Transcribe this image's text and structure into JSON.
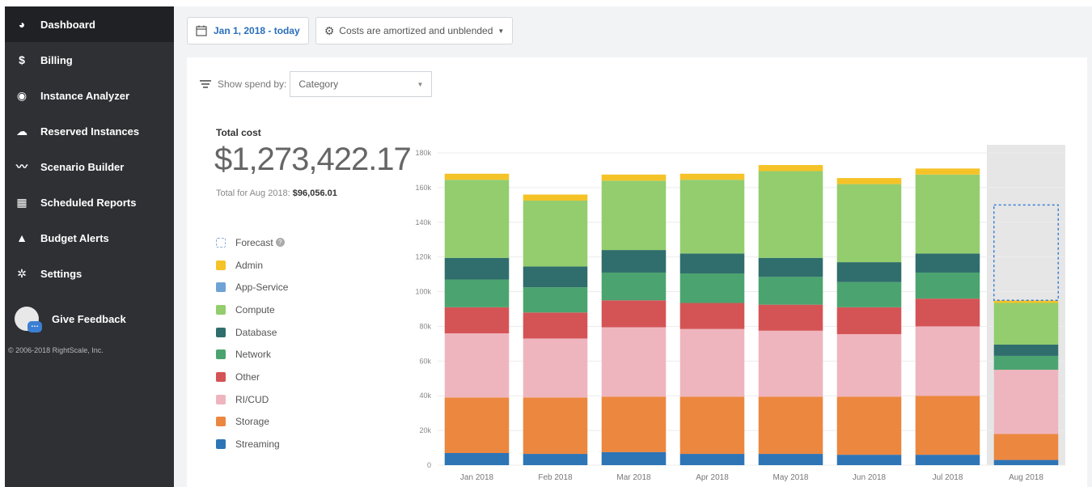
{
  "sidebar": {
    "items": [
      {
        "label": "Dashboard",
        "icon": "dashboard-icon",
        "active": true
      },
      {
        "label": "Billing",
        "icon": "dollar-icon"
      },
      {
        "label": "Instance Analyzer",
        "icon": "eye-icon"
      },
      {
        "label": "Reserved Instances",
        "icon": "cloud-reserved-icon"
      },
      {
        "label": "Scenario Builder",
        "icon": "pulse-icon"
      },
      {
        "label": "Scheduled Reports",
        "icon": "calendar-icon"
      },
      {
        "label": "Budget Alerts",
        "icon": "bell-icon"
      },
      {
        "label": "Settings",
        "icon": "gear-icon"
      }
    ],
    "feedback_label": "Give Feedback",
    "copyright": "© 2006-2018 RightScale, Inc."
  },
  "toolbar": {
    "date_range": "Jan 1, 2018 - today",
    "costs_label": "Costs are amortized and unblended"
  },
  "filters": {
    "show_spend_by_label": "Show spend by:",
    "category_value": "Category"
  },
  "summary": {
    "total_label": "Total cost",
    "total_value": "$1,273,422.17",
    "month_label": "Total for Aug 2018:",
    "month_value": "$96,056.01"
  },
  "legend": {
    "forecast": "Forecast",
    "items": [
      {
        "label": "Admin",
        "color": "#f5c327"
      },
      {
        "label": "App-Service",
        "color": "#6fa3d6"
      },
      {
        "label": "Compute",
        "color": "#93cd6e"
      },
      {
        "label": "Database",
        "color": "#2f6e6c"
      },
      {
        "label": "Network",
        "color": "#4ba46f"
      },
      {
        "label": "Other",
        "color": "#d45456"
      },
      {
        "label": "RI/CUD",
        "color": "#efb5be"
      },
      {
        "label": "Storage",
        "color": "#ec873f"
      },
      {
        "label": "Streaming",
        "color": "#2e75b6"
      }
    ]
  },
  "chart_data": {
    "type": "bar",
    "stacked": true,
    "categories": [
      "Jan 2018",
      "Feb 2018",
      "Mar 2018",
      "Apr 2018",
      "May 2018",
      "Jun 2018",
      "Jul 2018",
      "Aug 2018"
    ],
    "ylim": [
      0,
      180000
    ],
    "yticks": [
      "0",
      "20k",
      "40k",
      "60k",
      "80k",
      "100k",
      "120k",
      "140k",
      "160k",
      "180k"
    ],
    "series": [
      {
        "name": "Streaming",
        "color": "#2e75b6",
        "values": [
          7000,
          6500,
          7500,
          6500,
          6500,
          6000,
          6000,
          3000
        ]
      },
      {
        "name": "Storage",
        "color": "#ec873f",
        "values": [
          32000,
          32500,
          32000,
          33000,
          33000,
          33500,
          34000,
          15000
        ]
      },
      {
        "name": "RI/CUD",
        "color": "#efb5be",
        "values": [
          37000,
          34000,
          40000,
          39000,
          38000,
          36000,
          40000,
          37000
        ]
      },
      {
        "name": "Other",
        "color": "#d45456",
        "values": [
          15000,
          15000,
          15500,
          15000,
          15000,
          15500,
          16000,
          0
        ]
      },
      {
        "name": "Network",
        "color": "#4ba46f",
        "values": [
          16000,
          14500,
          16000,
          17000,
          16000,
          14500,
          15000,
          8000
        ]
      },
      {
        "name": "Database",
        "color": "#2f6e6c",
        "values": [
          12500,
          12000,
          13000,
          11500,
          11000,
          11500,
          11000,
          6500
        ]
      },
      {
        "name": "App-Service",
        "color": "#6fa3d6",
        "values": [
          0,
          0,
          0,
          0,
          0,
          0,
          0,
          0
        ]
      },
      {
        "name": "Compute",
        "color": "#93cd6e",
        "values": [
          45000,
          38000,
          40000,
          42500,
          50000,
          45000,
          45500,
          24000
        ]
      },
      {
        "name": "Admin",
        "color": "#f5c327",
        "values": [
          3500,
          3500,
          3500,
          3500,
          3500,
          3500,
          3500,
          1500
        ]
      }
    ],
    "forecast": {
      "category": "Aug 2018",
      "from": 95000,
      "to": 150000
    }
  }
}
